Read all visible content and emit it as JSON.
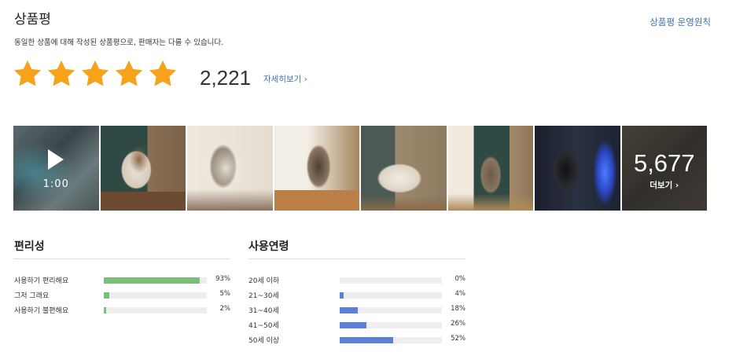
{
  "header": {
    "title": "상품평",
    "policy_link": "상품평 운영원칙",
    "description": "동일한 상품에 대해 작성된 상품평으로, 판매자는 다를 수 있습니다."
  },
  "rating": {
    "stars": 5,
    "star_color": "#f7a21b",
    "count": "2,221",
    "detail_link": "자세히보기 ›"
  },
  "photos": {
    "video_duration": "1:00",
    "more_count": "5,677",
    "more_label": "더보기 ›"
  },
  "convenience": {
    "title": "편리성",
    "bar_color": "#7cbf78",
    "items": [
      {
        "label": "사용하기 편리해요",
        "percent_text": "93%",
        "value": 93
      },
      {
        "label": "그저 그래요",
        "percent_text": "5%",
        "value": 5
      },
      {
        "label": "사용하기 불편해요",
        "percent_text": "2%",
        "value": 2
      }
    ]
  },
  "age": {
    "title": "사용연령",
    "bar_color": "#5b80d8",
    "items": [
      {
        "label": "20세 이하",
        "percent_text": "0%",
        "value": 0
      },
      {
        "label": "21~30세",
        "percent_text": "4%",
        "value": 4
      },
      {
        "label": "31~40세",
        "percent_text": "18%",
        "value": 18
      },
      {
        "label": "41~50세",
        "percent_text": "26%",
        "value": 26
      },
      {
        "label": "50세 이상",
        "percent_text": "52%",
        "value": 52
      }
    ]
  }
}
